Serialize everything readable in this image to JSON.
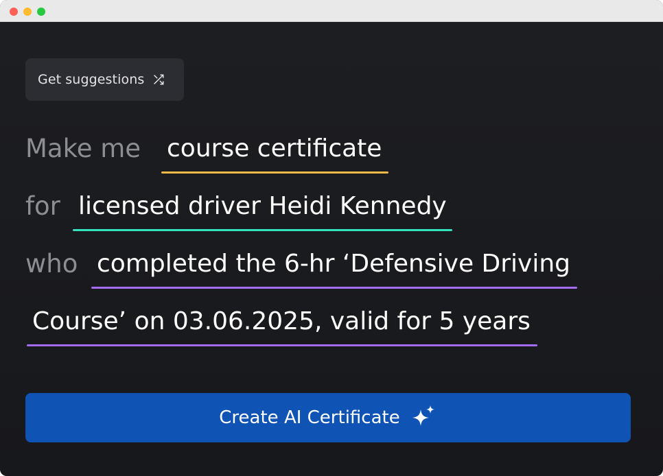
{
  "window": {
    "controls": [
      "close",
      "minimize",
      "maximize"
    ]
  },
  "suggestions": {
    "label": "Get suggestions",
    "icon": "shuffle-icon"
  },
  "prompt": {
    "prefix_make": "Make me",
    "field_type": "course certificate",
    "prefix_for": "for",
    "field_recipient": "licensed driver Heidi Kennedy",
    "prefix_who": "who",
    "field_achievement_line1": "completed the 6-hr ‘Defensive Driving",
    "field_achievement_line2": "Course’ on 03.06.2025, valid for 5 years"
  },
  "create": {
    "label": "Create AI Certificate",
    "icon": "sparkle-icon"
  },
  "colors": {
    "background": "#1b1c20",
    "accent_button": "#0f54b5",
    "underline_type": "#f0b94a",
    "underline_recipient": "#33e3bd",
    "underline_achievement": "#a46cf0"
  }
}
